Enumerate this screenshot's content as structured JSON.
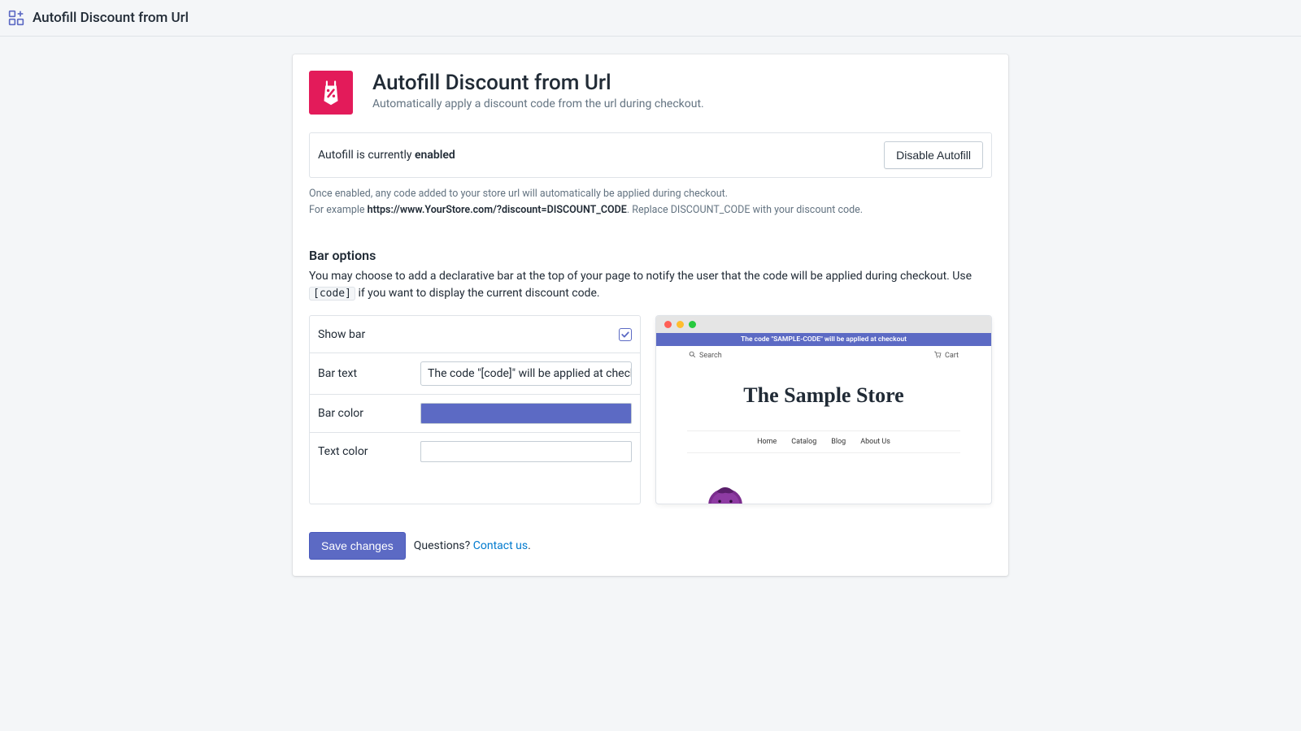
{
  "topbar": {
    "title": "Autofill Discount from Url"
  },
  "app": {
    "title": "Autofill Discount from Url",
    "subtitle": "Automatically apply a discount code from the url during checkout."
  },
  "status": {
    "prefix": "Autofill is currently ",
    "state": "enabled",
    "button": "Disable Autofill"
  },
  "help": {
    "line1": "Once enabled, any code added to your store url will automatically be applied during checkout.",
    "line2_prefix": "For example ",
    "line2_url": "https://www.YourStore.com/?discount=DISCOUNT_CODE",
    "line2_suffix": ". Replace DISCOUNT_CODE with your discount code."
  },
  "barSection": {
    "title": "Bar options",
    "desc_a": "You may choose to add a declarative bar at the top of your page to notify the user that the code will be applied during checkout. Use ",
    "desc_code": "[code]",
    "desc_b": " if you want to display the current discount code."
  },
  "options": {
    "showBar": {
      "label": "Show bar",
      "checked": true
    },
    "barText": {
      "label": "Bar text",
      "value": "The code \"[code]\" will be applied at check"
    },
    "barColor": {
      "label": "Bar color",
      "value": "#5c6ac4"
    },
    "textColor": {
      "label": "Text color",
      "value": "#ffffff"
    }
  },
  "preview": {
    "barMessage": "The code \"SAMPLE-CODE\" will be applied at checkout",
    "search": "Search",
    "cart": "Cart",
    "storeTitle": "The Sample Store",
    "menu": [
      "Home",
      "Catalog",
      "Blog",
      "About Us"
    ]
  },
  "footer": {
    "saveLabel": "Save changes",
    "questions": "Questions? ",
    "contact": "Contact us",
    "period": "."
  }
}
